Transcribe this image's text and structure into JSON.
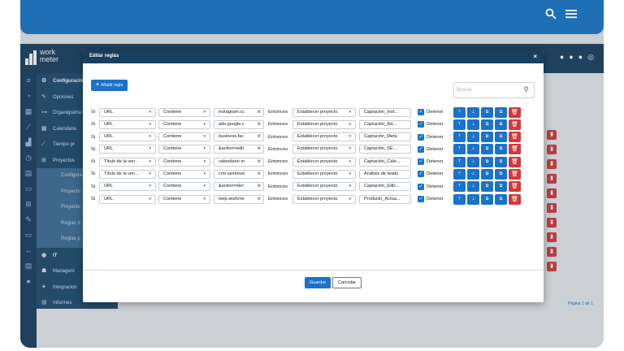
{
  "device_bar": {
    "search_icon": "search-icon",
    "menu_icon": "hamburger-icon"
  },
  "app": {
    "logo_line1": "work",
    "logo_line2": "meter",
    "header_icons": [
      "bell-icon",
      "help-icon",
      "globe-icon",
      "user-icon"
    ]
  },
  "sidebar": {
    "section_title": "Configuración",
    "items": [
      {
        "label": "Opciones",
        "icon": "wrench-icon"
      },
      {
        "label": "Organigrama",
        "icon": "org-icon"
      },
      {
        "label": "Calendario",
        "icon": "calendar-icon"
      },
      {
        "label": "Tiempo pr",
        "icon": "chart-icon"
      },
      {
        "label": "Proyectos",
        "icon": "grid-icon"
      }
    ],
    "sub_items": [
      "Configura",
      "Proyecto",
      "Proyecto",
      "Reglas d",
      "Reglas p"
    ],
    "bottom_items": [
      {
        "label": "IT",
        "icon": "location-icon"
      },
      {
        "label": "Managers",
        "icon": "users-icon"
      },
      {
        "label": "Integracion",
        "icon": "puzzle-icon"
      },
      {
        "label": "Informes",
        "icon": "report-icon"
      }
    ]
  },
  "background": {
    "pager": "Página 1 de 1"
  },
  "modal": {
    "title": "Editar reglas",
    "close": "×",
    "add_rule": "Añadir regla",
    "search_placeholder": "Buscar",
    "save": "Guardar",
    "cancel": "Cancelar"
  },
  "rule_labels": {
    "if": "Si",
    "then": "Entonces",
    "stop": "Detener"
  },
  "rules": [
    {
      "field": "URL",
      "op": "Contiene",
      "value": "instagram.cc",
      "action": "Establecer proyecto",
      "target": "Captación_Inst...",
      "stop": true
    },
    {
      "field": "URL",
      "op": "Contiene",
      "value": "ads.google.c",
      "action": "Establecer proyecto",
      "target": "Captación_Ad...",
      "stop": true
    },
    {
      "field": "URL",
      "op": "Contiene",
      "value": "business.fac",
      "action": "Establecer proyecto",
      "target": "Captación_Meta",
      "stop": true
    },
    {
      "field": "URL",
      "op": "Contiene",
      "value": "&action=edit",
      "action": "Establecer proyecto",
      "target": "Captación_SE...",
      "stop": true
    },
    {
      "field": "Título de la ven...",
      "op": "Contiene",
      "value": "calendario m",
      "action": "Establecer proyecto",
      "target": "Captación_Cale...",
      "stop": true
    },
    {
      "field": "Título de la ven...",
      "op": "Contiene",
      "value": "crm.workmet",
      "action": "Establecer proyecto",
      "target": "Análisis de leads",
      "stop": true
    },
    {
      "field": "URL",
      "op": "Contiene",
      "value": "&action=eler",
      "action": "Establecer proyecto",
      "target": "Captación_Edic...",
      "stop": true
    },
    {
      "field": "URL",
      "op": "Contiene",
      "value": "help.workme",
      "action": "Establecer proyecto",
      "target": "Producto_Actua...",
      "stop": true
    }
  ],
  "rule_actions": {
    "top": "⤒",
    "up": "⊥",
    "copy": "⧉",
    "paste": "⧉",
    "delete": "🗑"
  }
}
